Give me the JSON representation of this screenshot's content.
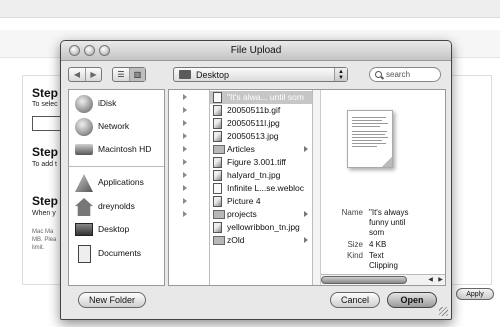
{
  "background_page": {
    "steps": [
      {
        "title": "Step",
        "subtitle": "To selec"
      },
      {
        "title": "Step",
        "subtitle": "To add t"
      },
      {
        "title": "Step",
        "subtitle": "When y"
      }
    ],
    "fine_print": [
      "Mac Ma",
      "MB. Plea",
      "limit."
    ],
    "apply_label": "Apply"
  },
  "dialog": {
    "title": "File Upload",
    "toolbar": {
      "back_glyph": "◀",
      "forward_glyph": "▶",
      "list_view_glyph": "☰",
      "column_view_glyph": "▥",
      "location": "Desktop",
      "search_placeholder": "search"
    },
    "sidebar": {
      "devices": [
        {
          "label": "iDisk",
          "icon": "idisk-icon"
        },
        {
          "label": "Network",
          "icon": "network-icon"
        },
        {
          "label": "Macintosh HD",
          "icon": "hard-drive-icon"
        }
      ],
      "places": [
        {
          "label": "Applications",
          "icon": "applications-icon"
        },
        {
          "label": "dreynolds",
          "icon": "home-icon"
        },
        {
          "label": "Desktop",
          "icon": "desktop-icon"
        },
        {
          "label": "Documents",
          "icon": "documents-icon"
        }
      ]
    },
    "files": [
      {
        "name": "\"It's alwa... until som",
        "kind": "text",
        "selected": true
      },
      {
        "name": "20050511b.gif",
        "kind": "img"
      },
      {
        "name": "20050511l.jpg",
        "kind": "img"
      },
      {
        "name": "20050513.jpg",
        "kind": "img"
      },
      {
        "name": "Articles",
        "kind": "folder"
      },
      {
        "name": "Figure 3.001.tiff",
        "kind": "img"
      },
      {
        "name": "halyard_tn.jpg",
        "kind": "img"
      },
      {
        "name": "Infinite L...se.webloc",
        "kind": "text"
      },
      {
        "name": "Picture 4",
        "kind": "img"
      },
      {
        "name": "projects",
        "kind": "folder"
      },
      {
        "name": "yellowribbon_tn.jpg",
        "kind": "img"
      },
      {
        "name": "zOld",
        "kind": "folder"
      }
    ],
    "preview": {
      "name_key": "Name",
      "name_value_line1": "\"It's always",
      "name_value_line2": "funny until",
      "name_value_line3": "som",
      "size_key": "Size",
      "size_value": "4 KB",
      "kind_key": "Kind",
      "kind_value_line1": "Text",
      "kind_value_line2": "Clipping"
    },
    "buttons": {
      "new_folder": "New Folder",
      "cancel": "Cancel",
      "open": "Open"
    }
  }
}
